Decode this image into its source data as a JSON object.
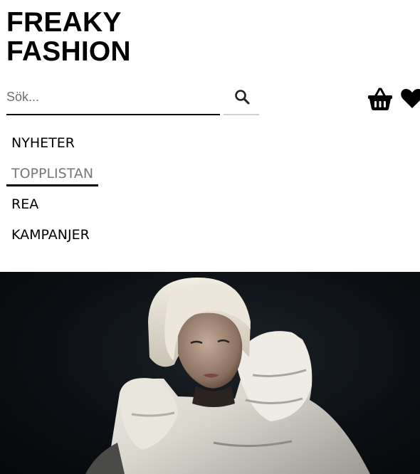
{
  "brand": {
    "line1": "FREAKY",
    "line2": "FASHION"
  },
  "search": {
    "placeholder": "Sök...",
    "value": "",
    "button_icon": "search-icon"
  },
  "header_icons": {
    "cart_icon": "basket-icon",
    "favorites_icon": "heart-icon"
  },
  "nav": {
    "items": [
      {
        "label": "NYHETER",
        "active": false
      },
      {
        "label": "TOPPLISTAN",
        "active": true
      },
      {
        "label": "REA",
        "active": false
      },
      {
        "label": "KAMPANJER",
        "active": false
      }
    ]
  },
  "hero": {
    "image_subject": "model-in-white-puffer-jacket"
  },
  "colors": {
    "text": "#000000",
    "active_nav_text": "#777777",
    "hero_background": "#0c1014",
    "jacket": "#e8e6e0"
  }
}
